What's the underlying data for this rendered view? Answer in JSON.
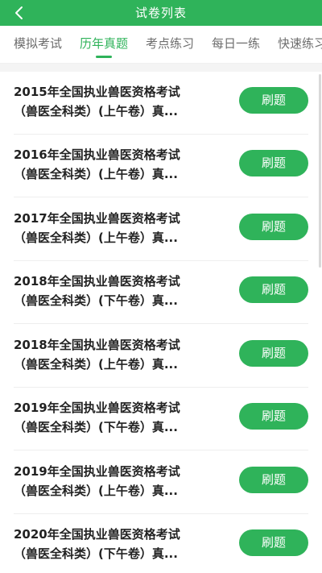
{
  "header": {
    "title": "试卷列表",
    "back_icon": "chevron-left-icon"
  },
  "tabs": [
    {
      "label": "模拟考试",
      "active": false
    },
    {
      "label": "历年真题",
      "active": true
    },
    {
      "label": "考点练习",
      "active": false
    },
    {
      "label": "每日一练",
      "active": false
    },
    {
      "label": "快速练习",
      "active": false
    }
  ],
  "papers": [
    {
      "line1": "2015年全国执业兽医资格考试",
      "line2": "（兽医全科类）(上午卷）真...",
      "button": "刷题"
    },
    {
      "line1": "2016年全国执业兽医资格考试",
      "line2": "（兽医全科类）(上午卷）真...",
      "button": "刷题"
    },
    {
      "line1": "2017年全国执业兽医资格考试",
      "line2": "（兽医全科类）(上午卷）真...",
      "button": "刷题"
    },
    {
      "line1": "2018年全国执业兽医资格考试",
      "line2": "（兽医全科类）(下午卷）真...",
      "button": "刷题"
    },
    {
      "line1": "2018年全国执业兽医资格考试",
      "line2": "（兽医全科类）(上午卷）真...",
      "button": "刷题"
    },
    {
      "line1": "2019年全国执业兽医资格考试",
      "line2": "（兽医全科类）(下午卷）真...",
      "button": "刷题"
    },
    {
      "line1": "2019年全国执业兽医资格考试",
      "line2": "（兽医全科类）(上午卷）真...",
      "button": "刷题"
    },
    {
      "line1": "2020年全国执业兽医资格考试",
      "line2": "（兽医全科类）(下午卷）真...",
      "button": "刷题"
    }
  ],
  "colors": {
    "accent": "#2fb35a",
    "tab_inactive": "#6d6d6d",
    "text": "#222222"
  }
}
